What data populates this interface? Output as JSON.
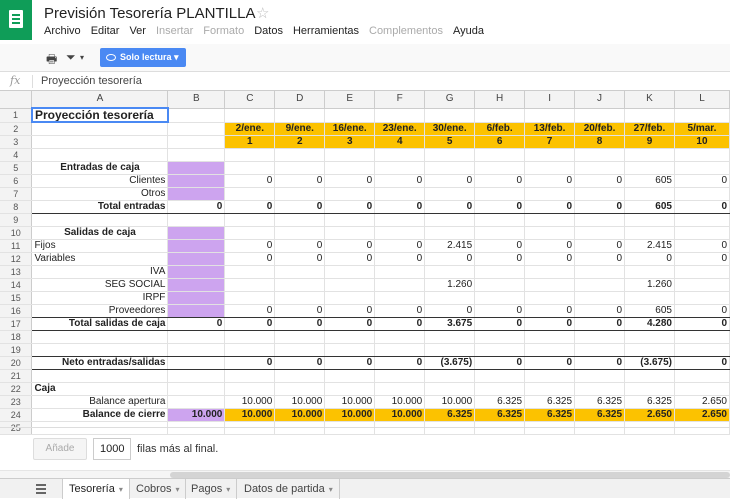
{
  "app": {
    "title": "Previsión Tesorería PLANTILLA",
    "star_icon": "star-icon",
    "menu": [
      "Archivo",
      "Editar",
      "Ver",
      "Insertar",
      "Formato",
      "Datos",
      "Herramientas",
      "Complementos",
      "Ayuda"
    ],
    "menu_disabled": [
      3,
      4,
      7
    ],
    "readonly_label": "Solo lectura ▾"
  },
  "formula": {
    "label": "fx",
    "value": "Proyección tesorería"
  },
  "colors": {
    "yellow": "#fcc200",
    "purple": "#cda4ef",
    "brand": "#0f9d58",
    "accent": "#4a89f3"
  },
  "columns": [
    "A",
    "B",
    "C",
    "D",
    "E",
    "F",
    "G",
    "H",
    "I",
    "J",
    "K",
    "L"
  ],
  "rows": [
    {
      "n": "1",
      "cells": [
        "Proyección tesorería",
        "",
        "",
        "",
        "",
        "",
        "",
        "",
        "",
        "",
        "",
        ""
      ]
    },
    {
      "n": "2",
      "cells": [
        "",
        "",
        "2/ene.",
        "9/ene.",
        "16/ene.",
        "23/ene.",
        "30/ene.",
        "6/feb.",
        "13/feb.",
        "20/feb.",
        "27/feb.",
        "5/mar."
      ]
    },
    {
      "n": "3",
      "cells": [
        "",
        "",
        "1",
        "2",
        "3",
        "4",
        "5",
        "6",
        "7",
        "8",
        "9",
        "10"
      ]
    },
    {
      "n": "4",
      "cells": [
        "",
        "",
        "",
        "",
        "",
        "",
        "",
        "",
        "",
        "",
        "",
        ""
      ]
    },
    {
      "n": "5",
      "cells": [
        "Entradas de caja",
        "",
        "",
        "",
        "",
        "",
        "",
        "",
        "",
        "",
        "",
        ""
      ]
    },
    {
      "n": "6",
      "cells": [
        "Clientes",
        "",
        "0",
        "0",
        "0",
        "0",
        "0",
        "0",
        "0",
        "0",
        "605",
        "0"
      ]
    },
    {
      "n": "7",
      "cells": [
        "Otros",
        "",
        "",
        "",
        "",
        "",
        "",
        "",
        "",
        "",
        "",
        ""
      ]
    },
    {
      "n": "8",
      "cells": [
        "Total entradas",
        "0",
        "0",
        "0",
        "0",
        "0",
        "0",
        "0",
        "0",
        "0",
        "605",
        "0"
      ]
    },
    {
      "n": "9",
      "cells": [
        "",
        "",
        "",
        "",
        "",
        "",
        "",
        "",
        "",
        "",
        "",
        ""
      ]
    },
    {
      "n": "10",
      "cells": [
        "Salidas de caja",
        "",
        "",
        "",
        "",
        "",
        "",
        "",
        "",
        "",
        "",
        ""
      ]
    },
    {
      "n": "11",
      "cells": [
        "Fijos",
        "",
        "0",
        "0",
        "0",
        "0",
        "2.415",
        "0",
        "0",
        "0",
        "2.415",
        "0"
      ]
    },
    {
      "n": "12",
      "cells": [
        "Variables",
        "",
        "0",
        "0",
        "0",
        "0",
        "0",
        "0",
        "0",
        "0",
        "0",
        "0"
      ]
    },
    {
      "n": "13",
      "cells": [
        "IVA",
        "",
        "",
        "",
        "",
        "",
        "",
        "",
        "",
        "",
        "",
        ""
      ]
    },
    {
      "n": "14",
      "cells": [
        "SEG SOCIAL",
        "",
        "",
        "",
        "",
        "",
        "1.260",
        "",
        "",
        "",
        "1.260",
        ""
      ]
    },
    {
      "n": "15",
      "cells": [
        "IRPF",
        "",
        "",
        "",
        "",
        "",
        "",
        "",
        "",
        "",
        "",
        ""
      ]
    },
    {
      "n": "16",
      "cells": [
        "Proveedores",
        "",
        "0",
        "0",
        "0",
        "0",
        "0",
        "0",
        "0",
        "0",
        "605",
        "0"
      ]
    },
    {
      "n": "17",
      "cells": [
        "Total salidas de caja",
        "0",
        "0",
        "0",
        "0",
        "0",
        "3.675",
        "0",
        "0",
        "0",
        "4.280",
        "0"
      ]
    },
    {
      "n": "18",
      "cells": [
        "",
        "",
        "",
        "",
        "",
        "",
        "",
        "",
        "",
        "",
        "",
        ""
      ]
    },
    {
      "n": "19",
      "cells": [
        "",
        "",
        "",
        "",
        "",
        "",
        "",
        "",
        "",
        "",
        "",
        ""
      ]
    },
    {
      "n": "20",
      "cells": [
        "Neto entradas/salidas",
        "",
        "0",
        "0",
        "0",
        "0",
        "(3.675)",
        "0",
        "0",
        "0",
        "(3.675)",
        "0"
      ]
    },
    {
      "n": "21",
      "cells": [
        "",
        "",
        "",
        "",
        "",
        "",
        "",
        "",
        "",
        "",
        "",
        ""
      ]
    },
    {
      "n": "22",
      "cells": [
        "Caja",
        "",
        "",
        "",
        "",
        "",
        "",
        "",
        "",
        "",
        "",
        ""
      ]
    },
    {
      "n": "23",
      "cells": [
        "Balance apertura",
        "",
        "10.000",
        "10.000",
        "10.000",
        "10.000",
        "10.000",
        "6.325",
        "6.325",
        "6.325",
        "6.325",
        "2.650"
      ]
    },
    {
      "n": "24",
      "cells": [
        "Balance de cierre",
        "10.000",
        "10.000",
        "10.000",
        "10.000",
        "10.000",
        "6.325",
        "6.325",
        "6.325",
        "6.325",
        "2.650",
        "2.650"
      ]
    },
    {
      "n": "25",
      "cells": [
        "",
        "",
        "",
        "",
        "",
        "",
        "",
        "",
        "",
        "",
        "",
        ""
      ]
    }
  ],
  "add_rows": {
    "button": "Añade",
    "count": "1000",
    "text": "filas más al final."
  },
  "tabs": [
    "Tesorería",
    "Cobros",
    "Pagos",
    "Datos de partida"
  ]
}
